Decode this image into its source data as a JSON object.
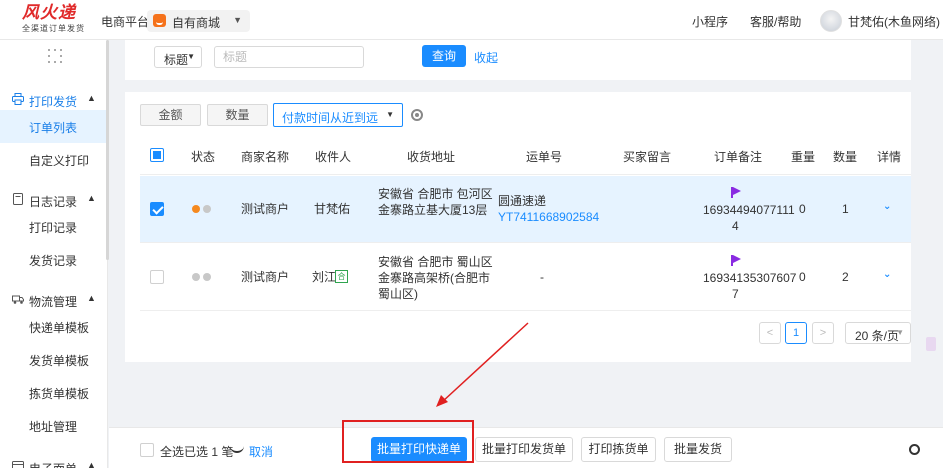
{
  "topbar": {
    "logo_title": "风火递",
    "logo_subtitle": "全渠道订单发货",
    "platform_label": "电商平台",
    "shop_name": "自有商城",
    "links": [
      "小程序",
      "客服/帮助"
    ],
    "username": "甘梵佑(木鱼网络)"
  },
  "sidebar": {
    "groups": [
      {
        "label": "打印发货",
        "icon": "printer-icon",
        "items": [
          "订单列表",
          "自定义打印"
        ]
      },
      {
        "label": "日志记录",
        "icon": "log-icon",
        "items": [
          "打印记录",
          "发货记录"
        ]
      },
      {
        "label": "物流管理",
        "icon": "logistics-icon",
        "items": [
          "快递单模板",
          "发货单模板",
          "拣货单模板",
          "地址管理"
        ]
      },
      {
        "label": "电子面单",
        "icon": "waybill-icon",
        "items": []
      }
    ],
    "active_item": "订单列表"
  },
  "filter": {
    "field_select": "标题",
    "input_placeholder": "标题",
    "query_label": "查询",
    "collapse_label": "收起"
  },
  "sort": {
    "amount_label": "金额",
    "quantity_label": "数量",
    "order_select": "付款时间从近到远"
  },
  "table": {
    "headers": [
      "状态",
      "商家名称",
      "收件人",
      "收货地址",
      "运单号",
      "买家留言",
      "订单备注",
      "重量",
      "数量",
      "详情"
    ],
    "rows": [
      {
        "selected": true,
        "merchant": "测试商户",
        "recipient": "甘梵佑",
        "address_lines": [
          "安徽省 合肥市 包河区",
          "金寨路立基大厦13层"
        ],
        "carrier": "圆通速递",
        "tracking_no": "YT7411668902584",
        "buyer_message": "",
        "remark_lines": [
          "16934494077111",
          "4"
        ],
        "weight": "0",
        "quantity": "1"
      },
      {
        "selected": false,
        "merchant": "测试商户",
        "recipient": "刘江",
        "recipient_tag": "合",
        "address_lines": [
          "安徽省 合肥市 蜀山区",
          "金寨路高架桥(合肥市",
          "蜀山区)"
        ],
        "tracking_no": "-",
        "buyer_message": "",
        "remark_lines": [
          "16934135307607",
          "7"
        ],
        "weight": "0",
        "quantity": "2"
      }
    ]
  },
  "pagination": {
    "prev": "<",
    "current_page": "1",
    "next": ">",
    "page_size": "20 条/页"
  },
  "bottom": {
    "select_all": "全选",
    "selected_count": "已选 1 笔",
    "cancel_label": "取消",
    "buttons": [
      "批量打印快递单",
      "批量打印发货单",
      "打印拣货单",
      "批量发货"
    ]
  },
  "colors": {
    "primary": "#1a8cff",
    "selected_row": "#e6f3ff",
    "annotation": "#e02020",
    "status_orange": "#f5891f",
    "flag_purple": "#8a2be2"
  }
}
